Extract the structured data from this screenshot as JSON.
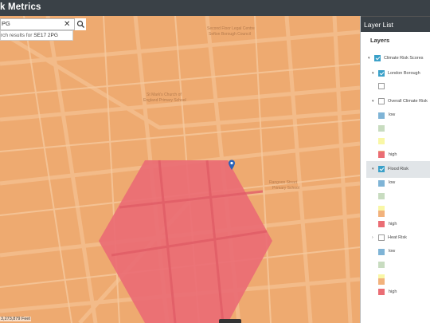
{
  "header": {
    "title": "k Metrics"
  },
  "search": {
    "value": "PG",
    "suggestion_prefix": "rch results for ",
    "suggestion_bold": "SE17 2PG",
    "clear_label": "✕"
  },
  "map": {
    "scale_text": "3,273,879 Feet",
    "place_labels": [
      "Second Floor Legal Centre",
      "Sefton Borough Council",
      "St Mark's Church of",
      "England Primary School",
      "Rangoon Street",
      "Primary School"
    ],
    "polygon_color": "#ea6d74",
    "base_color": "#eeaa70"
  },
  "layer_panel": {
    "title": "Layer List",
    "subtitle": "Layers",
    "items": {
      "climate": "Climate Risk Scores",
      "borough": "London Borough",
      "overall": "Overall Climate Risk",
      "flood": "Flood Risk",
      "heat": "Heat Risk"
    },
    "legend_labels": {
      "low": "low",
      "high": "high"
    },
    "ramp": [
      "#7fb4d6",
      "#c8dcc0",
      "#f9f7a6",
      "#f2b27c",
      "#ea6d74"
    ]
  }
}
